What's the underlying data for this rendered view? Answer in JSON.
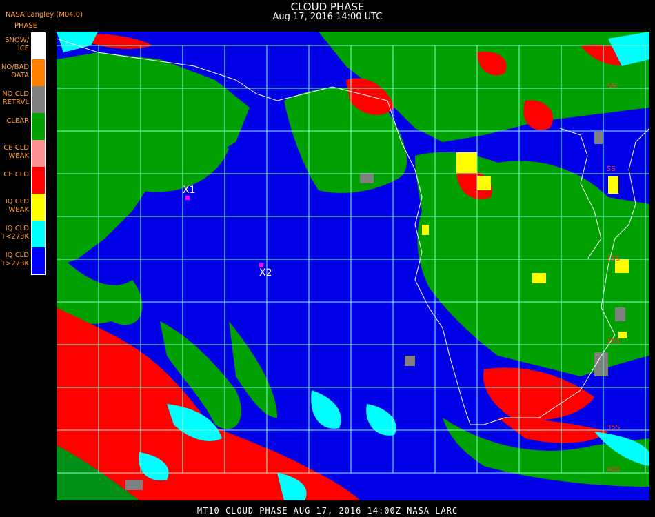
{
  "header": {
    "title": "CLOUD PHASE",
    "subtitle": "Aug 17, 2016 14:00 UTC",
    "source": "NASA Langley (M04.0)"
  },
  "legend": {
    "title": "PHASE",
    "items": [
      {
        "label_1": "SNOW/",
        "label_2": "ICE",
        "color": "#ffffff"
      },
      {
        "label_1": "NO/BAD",
        "label_2": "DATA",
        "color": "#ff8000"
      },
      {
        "label_1": "NO CLD",
        "label_2": "RETRVL",
        "color": "#808080"
      },
      {
        "label_1": "CLEAR",
        "label_2": "",
        "color": "#00a000"
      },
      {
        "label_1": "CE CLD",
        "label_2": "WEAK",
        "color": "#ff9090"
      },
      {
        "label_1": "CE CLD",
        "label_2": "",
        "color": "#ff0000"
      },
      {
        "label_1": "IQ CLD",
        "label_2": "WEAK",
        "color": "#ffff00"
      },
      {
        "label_1": "IQ CLD",
        "label_2": "T<273K",
        "color": "#00ffff"
      },
      {
        "label_1": "IQ CLD",
        "label_2": "T>273K",
        "color": "#0000ff"
      }
    ]
  },
  "map": {
    "grid_color": "#7fffd4",
    "coast_color": "#ffffff",
    "markers": [
      {
        "label": "X1"
      },
      {
        "label": "X2"
      }
    ],
    "lat_labels": [
      "5N",
      "5S",
      "15S",
      "25S",
      "35S",
      "40S"
    ]
  },
  "footer": {
    "text": "MT10  CLOUD PHASE   AUG 17, 2016 14:00Z   NASA LARC"
  }
}
